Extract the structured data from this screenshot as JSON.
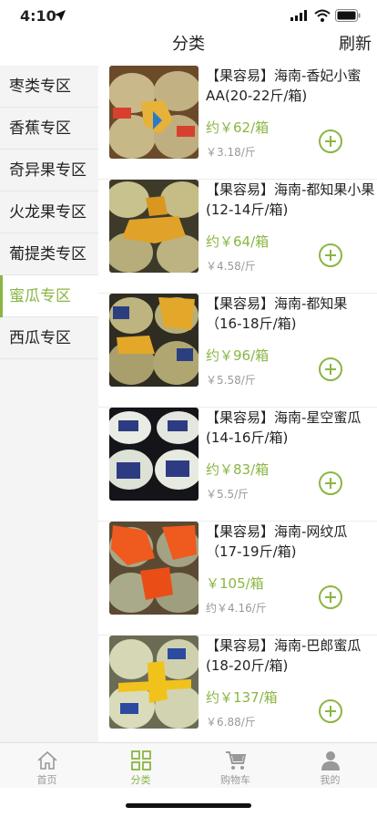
{
  "status": {
    "time": "4:10"
  },
  "nav": {
    "title": "分类",
    "refresh": "刷新"
  },
  "categories": [
    {
      "label": "枣类专区"
    },
    {
      "label": "香蕉专区"
    },
    {
      "label": "奇异果专区"
    },
    {
      "label": "火龙果专区"
    },
    {
      "label": "葡提类专区"
    },
    {
      "label": "蜜瓜专区"
    },
    {
      "label": "西瓜专区"
    }
  ],
  "active_category_index": 5,
  "products": [
    {
      "name": "【果容易】海南-香妃小蜜AA(20-22斤/箱)",
      "price": "约￥62/箱",
      "unit_price": "￥3.18/斤"
    },
    {
      "name": "【果容易】海南-都知果小果(12-14斤/箱)",
      "price": "约￥64/箱",
      "unit_price": "￥4.58/斤"
    },
    {
      "name": "【果容易】海南-都知果（16-18斤/箱)",
      "price": "约￥96/箱",
      "unit_price": "￥5.58/斤"
    },
    {
      "name": "【果容易】海南-星空蜜瓜(14-16斤/箱)",
      "price": "约￥83/箱",
      "unit_price": "￥5.5/斤"
    },
    {
      "name": "【果容易】海南-网纹瓜（17-19斤/箱)",
      "price": "￥105/箱",
      "unit_price": "约￥4.16/斤"
    },
    {
      "name": "【果容易】海南-巴郎蜜瓜(18-20斤/箱)",
      "price": "约￥137/箱",
      "unit_price": "￥6.88/斤"
    }
  ],
  "tabs": [
    {
      "label": "首页",
      "icon": "home-icon"
    },
    {
      "label": "分类",
      "icon": "grid-icon"
    },
    {
      "label": "购物车",
      "icon": "cart-icon"
    },
    {
      "label": "我的",
      "icon": "user-icon"
    }
  ],
  "active_tab_index": 1,
  "colors": {
    "accent": "#8ab643",
    "muted": "#999999",
    "sidebar_bg": "#f4f4f4"
  }
}
